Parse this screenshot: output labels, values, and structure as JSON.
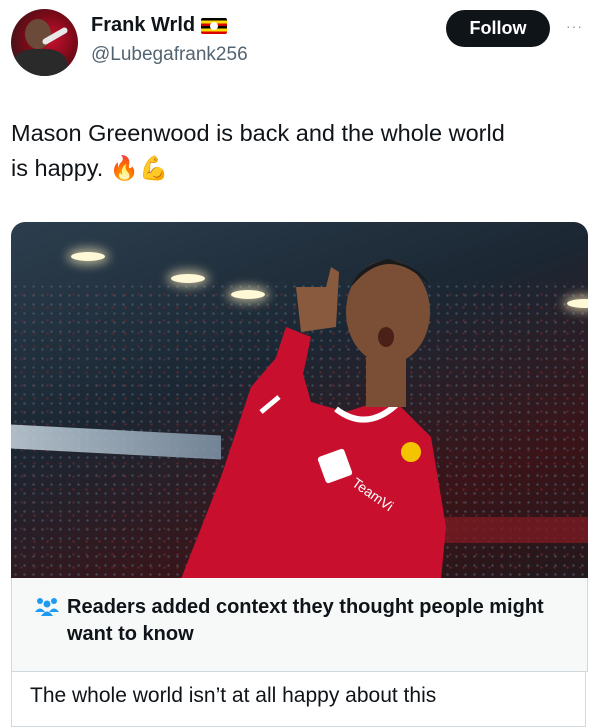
{
  "author": {
    "name": "Frank Wrld",
    "handle": "@Lubegafrank256",
    "flag_icon": "uganda-flag-icon"
  },
  "actions": {
    "follow_label": "Follow",
    "more_label": "···"
  },
  "tweet": {
    "line1": "Mason Greenwood is back and the whole world",
    "line2_text": "is happy.",
    "emojis": [
      "🔥",
      "💪"
    ]
  },
  "media": {
    "kind": "photo",
    "jersey_sponsor_text": "TeamVi"
  },
  "community_note": {
    "title": "Readers added context they thought people might want to know",
    "body": "The whole world isn’t at all happy about this",
    "icon": "people-icon"
  },
  "colors": {
    "follow_bg": "#0f1419",
    "secondary_text": "#536471",
    "note_bg": "#f7f9f9",
    "note_icon": "#1d9bf0"
  }
}
